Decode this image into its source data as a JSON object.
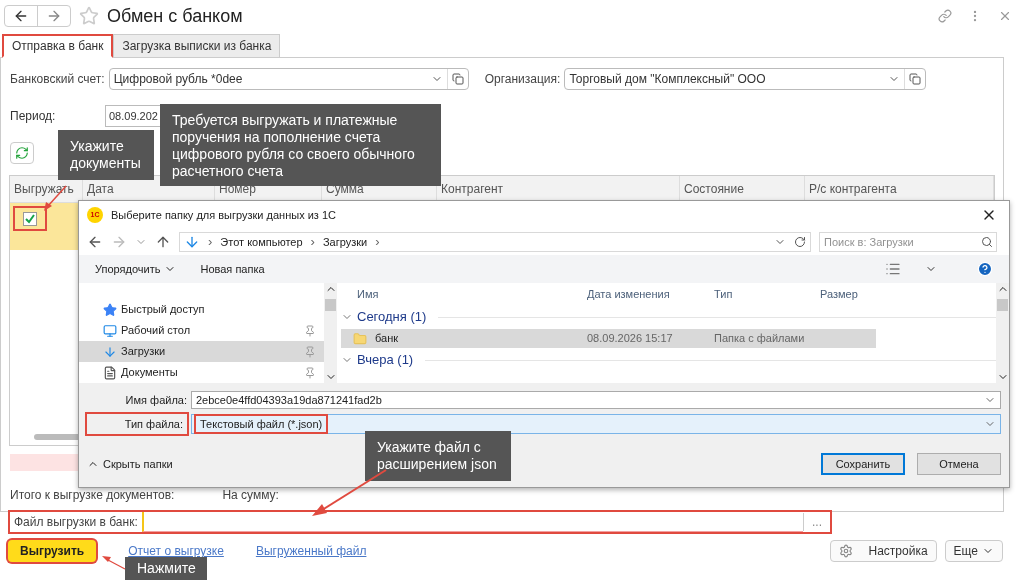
{
  "window": {
    "title": "Обмен с банком"
  },
  "tabs": [
    {
      "label": "Отправка в банк",
      "selected": true,
      "highlighted": true
    },
    {
      "label": "Загрузка выписки из банка",
      "selected": false,
      "highlighted": false
    }
  ],
  "bank_account": {
    "label": "Банковский счет:",
    "value": "Цифровой рубль *0dee"
  },
  "organization": {
    "label": "Организация:",
    "value": "Торговый дом \"Комплексный\" ООО"
  },
  "period": {
    "label": "Период:",
    "from": "08.09.202"
  },
  "table": {
    "columns": [
      "Выгружать",
      "Дата",
      "Номер",
      "Сумма",
      "Контрагент",
      "Состояние",
      "Р/с контрагента"
    ],
    "rows": [
      {
        "checked": true,
        "selected": true,
        "highlighted": true
      }
    ]
  },
  "totals": [
    "Итого к выгрузке документов:",
    "На сумму:"
  ],
  "export_file": {
    "label": "Файл выгрузки в банк:",
    "browse": "...",
    "highlighted": true
  },
  "actions": {
    "export": {
      "label": "Выгрузить",
      "highlighted": true
    },
    "report_link": "Отчет о выгрузке",
    "file_link": "Выгруженный файл",
    "settings": "Настройка",
    "more": "Еще"
  },
  "dialog": {
    "logo": "1С",
    "title": "Выберите папку для выгрузки данных из 1С",
    "path_separator": "›",
    "path": [
      "Этот компьютер",
      "Загрузки"
    ],
    "search": {
      "placeholder": "Поиск в: Загрузки"
    },
    "toolbar": [
      "Упорядочить",
      "Новая папка"
    ],
    "nav": [
      {
        "kind": "star",
        "label": "Быстрый доступ",
        "selected": false
      },
      {
        "kind": "desktop",
        "label": "Рабочий стол",
        "selected": false
      },
      {
        "kind": "download",
        "label": "Загрузки",
        "selected": true
      },
      {
        "kind": "document",
        "label": "Документы",
        "selected": false
      }
    ],
    "columns": [
      "Имя",
      "Дата изменения",
      "Тип",
      "Размер"
    ],
    "groups": [
      {
        "label": "Сегодня (1)",
        "items": [
          {
            "name": "банк",
            "date": "08.09.2026 15:17",
            "type": "Папка с файлами",
            "selected": true
          }
        ]
      },
      {
        "label": "Вчера (1)"
      }
    ],
    "file_name": {
      "label": "Имя файла:",
      "value": "2ebce0e4ffd04393a19da871241fad2b"
    },
    "file_type": {
      "label": "Тип файла:",
      "value": "Текстовый файл (*.json)",
      "highlighted": true
    },
    "hide_folders": "Скрыть папки",
    "buttons": [
      {
        "label": "Сохранить",
        "default": true
      },
      {
        "label": "Отмена",
        "default": false
      }
    ]
  },
  "callouts": [
    {
      "text": "Укажите документы"
    },
    {
      "text": "Требуется выгружать и платежные поручения на пополнение счета цифрового рубля со своего обычного расчетного счета"
    },
    {
      "text": "Укажите файл с расширением json"
    },
    {
      "text": "Нажмите"
    }
  ]
}
